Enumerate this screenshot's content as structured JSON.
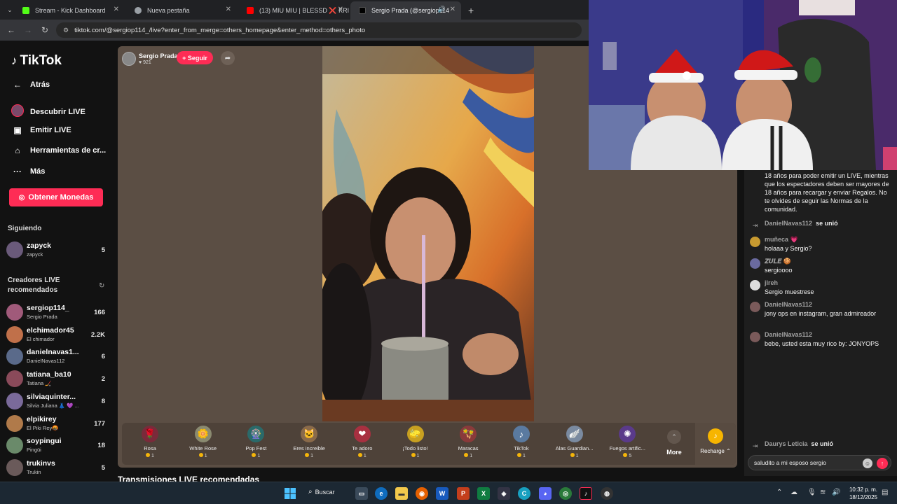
{
  "browser": {
    "tabs": [
      {
        "title": "Stream - Kick Dashboard",
        "color": "#53fc18"
      },
      {
        "title": "Nueva pestaña",
        "color": "#9aa0a6"
      },
      {
        "title": "(13) MIU MIU | BLESSD ❌ KRIS",
        "color": "#ff0000"
      },
      {
        "title": "Sergio Prada (@sergiop114",
        "color": "#000000"
      }
    ],
    "url": "tiktok.com/@sergiop114_/live?enter_from_merge=others_homepage&enter_method=others_photo"
  },
  "sidebar": {
    "logo": "TikTok",
    "nav": [
      {
        "label": "Atrás",
        "icon": "back-arrow-icon"
      },
      {
        "label": "Descubrir LIVE",
        "icon": "live-avatar-icon"
      },
      {
        "label": "Emitir LIVE",
        "icon": "camera-icon"
      },
      {
        "label": "Herramientas de cr...",
        "icon": "home-icon"
      },
      {
        "label": "Más",
        "icon": "more-dots-icon"
      }
    ],
    "coins_button": "Obtener Monedas",
    "following_heading": "Siguiendo",
    "following": [
      {
        "user": "zapyck",
        "name": "zapyck",
        "count": "5"
      }
    ],
    "recommended_heading": "Creadores LIVE recomendados",
    "recommended": [
      {
        "user": "sergiop114_",
        "name": "Sergio Prada",
        "count": "166"
      },
      {
        "user": "elchimador45",
        "name": "El chimador",
        "count": "2.2K"
      },
      {
        "user": "danielnavas1...",
        "name": "DanielNavas112",
        "count": "6"
      },
      {
        "user": "tatiana_ba10",
        "name": "Tatiana 🏒",
        "count": "2"
      },
      {
        "user": "silviaquinter...",
        "name": "Silvia Juliana 👗 💜 ...",
        "count": "8"
      },
      {
        "user": "elpikirey",
        "name": "El Piki Rey🤬",
        "count": "177"
      },
      {
        "user": "soypingui",
        "name": "Pingüi",
        "count": "18"
      },
      {
        "user": "trukinvs",
        "name": "Trukin",
        "count": "5"
      }
    ]
  },
  "live": {
    "host_name": "Sergio Prada",
    "viewer_count": "921",
    "follow_label": "+ Seguir",
    "gifts": [
      {
        "name": "Rosa",
        "price": "1",
        "icon": "🌹",
        "bg": "#7a2a3a"
      },
      {
        "name": "White Rose",
        "price": "1",
        "icon": "🌼",
        "bg": "#8a8a70"
      },
      {
        "name": "Pop Fest",
        "price": "1",
        "icon": "🎡",
        "bg": "#2a6a6a"
      },
      {
        "name": "Eres increible",
        "price": "1",
        "icon": "🐱",
        "bg": "#8a6a4a"
      },
      {
        "name": "Te adoro",
        "price": "1",
        "icon": "❤",
        "bg": "#a83040"
      },
      {
        "name": "¡Todo listo!",
        "price": "1",
        "icon": "🧽",
        "bg": "#c8a020"
      },
      {
        "name": "Maracas",
        "price": "1",
        "icon": "🪇",
        "bg": "#8a3a3a"
      },
      {
        "name": "TikTok",
        "price": "1",
        "icon": "♪",
        "bg": "#5a7aa0"
      },
      {
        "name": "Alas Guardian...",
        "price": "1",
        "icon": "🪽",
        "bg": "#7a8aa0"
      },
      {
        "name": "Fuegos artific...",
        "price": "5",
        "icon": "✺",
        "bg": "#5a3a8a"
      }
    ],
    "more_label": "More",
    "recharge_label": "Recharge",
    "recommended_heading": "Transmisiones LIVE recomendadas"
  },
  "chat": {
    "notice": "18 años para poder emitir un LIVE, mientras que los espectadores deben ser mayores de 18 años para recargar y enviar Regalos. No te olvides de seguir las Normas de la comunidad.",
    "messages": [
      {
        "user": "DanielNavas112",
        "text": "",
        "joined": "se unió",
        "type": "join"
      },
      {
        "user": "muñeca 💗",
        "text": "holaaa y Sergio?",
        "type": "msg"
      },
      {
        "user": "𝒁𝑼𝑳𝑬 🍪",
        "text": "sergioooo",
        "type": "msg"
      },
      {
        "user": "jlreh",
        "text": "Sergio muestrese",
        "type": "msg"
      },
      {
        "user": "DanielNavas112",
        "text": "jony ops en instagram, gran admireador",
        "type": "msg"
      },
      {
        "user": "DanielNavas112",
        "text": "bebe, usted esta muy rico by: JONYOPS",
        "type": "msg"
      },
      {
        "user": "Daurys Leticia",
        "text": "",
        "joined": "se unió",
        "type": "join"
      }
    ],
    "input_value": "saludito a mi esposo sergio"
  },
  "taskbar": {
    "search_label": "Buscar",
    "time": "10:32 p. m.",
    "date": "18/12/2025"
  }
}
